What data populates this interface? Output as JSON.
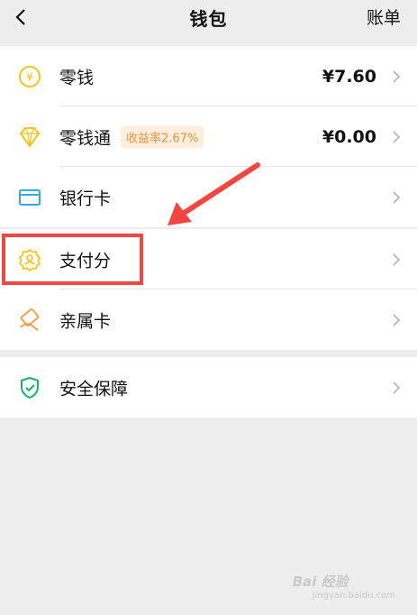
{
  "header": {
    "title": "钱包",
    "right_action": "账单"
  },
  "rows": {
    "change": {
      "label": "零钱",
      "value": "¥7.60"
    },
    "lct": {
      "label": "零钱通",
      "badge": "收益率2.67%",
      "value": "¥0.00"
    },
    "bank": {
      "label": "银行卡"
    },
    "payscore": {
      "label": "支付分"
    },
    "family": {
      "label": "亲属卡"
    },
    "security": {
      "label": "安全保障"
    }
  },
  "colors": {
    "gold": "#f0c419",
    "bank_blue": "#3aa8d8",
    "orange": "#f19a38",
    "green": "#16b36b",
    "annotation_red": "#f24640"
  },
  "watermark": {
    "brand": "Bai  经验",
    "url": "jingyan.baidu.com"
  }
}
